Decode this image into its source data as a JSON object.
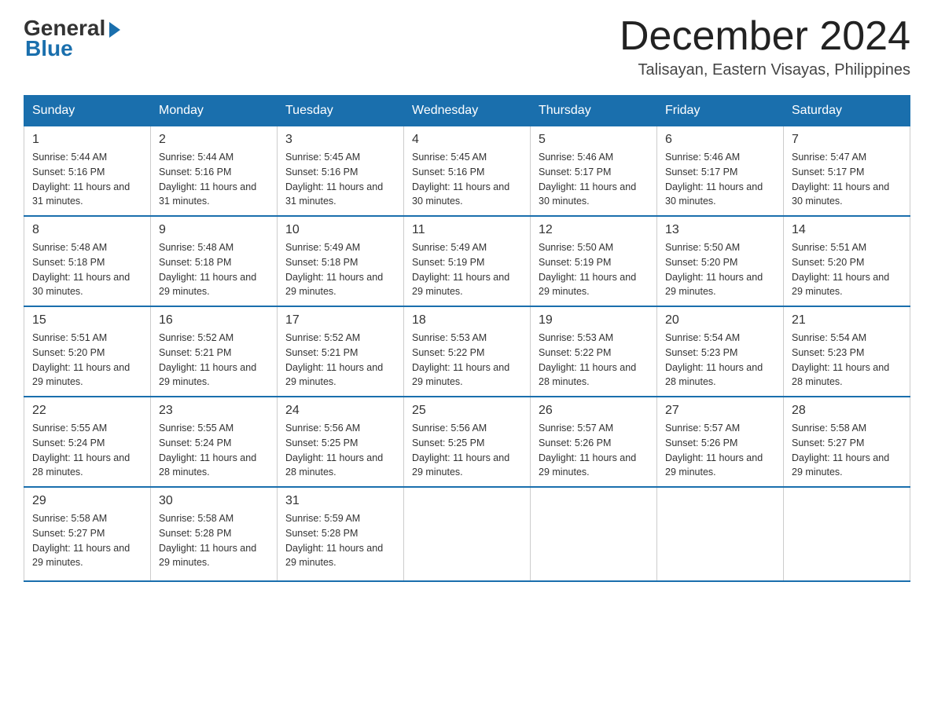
{
  "logo": {
    "general": "General",
    "blue": "Blue"
  },
  "header": {
    "month_year": "December 2024",
    "location": "Talisayan, Eastern Visayas, Philippines"
  },
  "weekdays": [
    "Sunday",
    "Monday",
    "Tuesday",
    "Wednesday",
    "Thursday",
    "Friday",
    "Saturday"
  ],
  "weeks": [
    [
      {
        "day": "1",
        "sunrise": "5:44 AM",
        "sunset": "5:16 PM",
        "daylight": "11 hours and 31 minutes."
      },
      {
        "day": "2",
        "sunrise": "5:44 AM",
        "sunset": "5:16 PM",
        "daylight": "11 hours and 31 minutes."
      },
      {
        "day": "3",
        "sunrise": "5:45 AM",
        "sunset": "5:16 PM",
        "daylight": "11 hours and 31 minutes."
      },
      {
        "day": "4",
        "sunrise": "5:45 AM",
        "sunset": "5:16 PM",
        "daylight": "11 hours and 30 minutes."
      },
      {
        "day": "5",
        "sunrise": "5:46 AM",
        "sunset": "5:17 PM",
        "daylight": "11 hours and 30 minutes."
      },
      {
        "day": "6",
        "sunrise": "5:46 AM",
        "sunset": "5:17 PM",
        "daylight": "11 hours and 30 minutes."
      },
      {
        "day": "7",
        "sunrise": "5:47 AM",
        "sunset": "5:17 PM",
        "daylight": "11 hours and 30 minutes."
      }
    ],
    [
      {
        "day": "8",
        "sunrise": "5:48 AM",
        "sunset": "5:18 PM",
        "daylight": "11 hours and 30 minutes."
      },
      {
        "day": "9",
        "sunrise": "5:48 AM",
        "sunset": "5:18 PM",
        "daylight": "11 hours and 29 minutes."
      },
      {
        "day": "10",
        "sunrise": "5:49 AM",
        "sunset": "5:18 PM",
        "daylight": "11 hours and 29 minutes."
      },
      {
        "day": "11",
        "sunrise": "5:49 AM",
        "sunset": "5:19 PM",
        "daylight": "11 hours and 29 minutes."
      },
      {
        "day": "12",
        "sunrise": "5:50 AM",
        "sunset": "5:19 PM",
        "daylight": "11 hours and 29 minutes."
      },
      {
        "day": "13",
        "sunrise": "5:50 AM",
        "sunset": "5:20 PM",
        "daylight": "11 hours and 29 minutes."
      },
      {
        "day": "14",
        "sunrise": "5:51 AM",
        "sunset": "5:20 PM",
        "daylight": "11 hours and 29 minutes."
      }
    ],
    [
      {
        "day": "15",
        "sunrise": "5:51 AM",
        "sunset": "5:20 PM",
        "daylight": "11 hours and 29 minutes."
      },
      {
        "day": "16",
        "sunrise": "5:52 AM",
        "sunset": "5:21 PM",
        "daylight": "11 hours and 29 minutes."
      },
      {
        "day": "17",
        "sunrise": "5:52 AM",
        "sunset": "5:21 PM",
        "daylight": "11 hours and 29 minutes."
      },
      {
        "day": "18",
        "sunrise": "5:53 AM",
        "sunset": "5:22 PM",
        "daylight": "11 hours and 29 minutes."
      },
      {
        "day": "19",
        "sunrise": "5:53 AM",
        "sunset": "5:22 PM",
        "daylight": "11 hours and 28 minutes."
      },
      {
        "day": "20",
        "sunrise": "5:54 AM",
        "sunset": "5:23 PM",
        "daylight": "11 hours and 28 minutes."
      },
      {
        "day": "21",
        "sunrise": "5:54 AM",
        "sunset": "5:23 PM",
        "daylight": "11 hours and 28 minutes."
      }
    ],
    [
      {
        "day": "22",
        "sunrise": "5:55 AM",
        "sunset": "5:24 PM",
        "daylight": "11 hours and 28 minutes."
      },
      {
        "day": "23",
        "sunrise": "5:55 AM",
        "sunset": "5:24 PM",
        "daylight": "11 hours and 28 minutes."
      },
      {
        "day": "24",
        "sunrise": "5:56 AM",
        "sunset": "5:25 PM",
        "daylight": "11 hours and 28 minutes."
      },
      {
        "day": "25",
        "sunrise": "5:56 AM",
        "sunset": "5:25 PM",
        "daylight": "11 hours and 29 minutes."
      },
      {
        "day": "26",
        "sunrise": "5:57 AM",
        "sunset": "5:26 PM",
        "daylight": "11 hours and 29 minutes."
      },
      {
        "day": "27",
        "sunrise": "5:57 AM",
        "sunset": "5:26 PM",
        "daylight": "11 hours and 29 minutes."
      },
      {
        "day": "28",
        "sunrise": "5:58 AM",
        "sunset": "5:27 PM",
        "daylight": "11 hours and 29 minutes."
      }
    ],
    [
      {
        "day": "29",
        "sunrise": "5:58 AM",
        "sunset": "5:27 PM",
        "daylight": "11 hours and 29 minutes."
      },
      {
        "day": "30",
        "sunrise": "5:58 AM",
        "sunset": "5:28 PM",
        "daylight": "11 hours and 29 minutes."
      },
      {
        "day": "31",
        "sunrise": "5:59 AM",
        "sunset": "5:28 PM",
        "daylight": "11 hours and 29 minutes."
      },
      null,
      null,
      null,
      null
    ]
  ],
  "labels": {
    "sunrise": "Sunrise:",
    "sunset": "Sunset:",
    "daylight": "Daylight:"
  }
}
